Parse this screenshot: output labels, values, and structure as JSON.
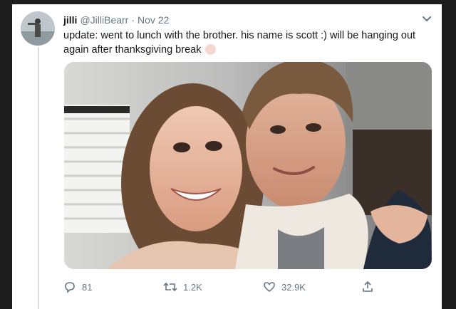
{
  "tweet": {
    "display_name": "jilli",
    "handle": "@JilliBearr",
    "separator": "·",
    "date": "Nov 22",
    "text": "update: went to lunch with the brother. his name is scott :) will be hanging out again after thanksgiving break"
  },
  "actions": {
    "reply_count": "81",
    "retweet_count": "1.2K",
    "like_count": "32.9K"
  },
  "icons": {
    "reply": "reply-icon",
    "retweet": "retweet-icon",
    "like": "heart-icon",
    "share": "share-icon",
    "menu": "chevron-down-icon"
  },
  "colors": {
    "text": "#14171a",
    "muted": "#657786",
    "border": "#d9dee2"
  }
}
